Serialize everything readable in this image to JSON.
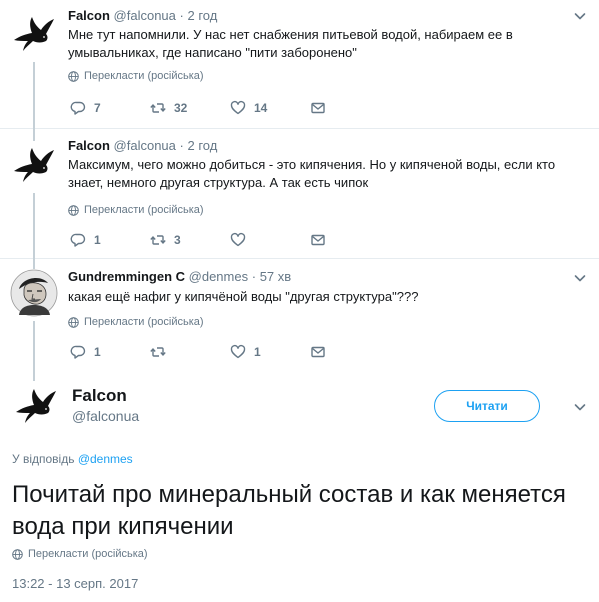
{
  "thread": [
    {
      "name": "Falcon",
      "handle": "@falconua",
      "dot": "·",
      "time": "2 год",
      "text": "Мне тут напомнили. У нас нет снабжения питьевой водой, набираем ее в умывальниках, где написано \"пити заборонено\"",
      "translate": "Перекласти (російська)",
      "replies": "7",
      "retweets": "32",
      "likes": "14",
      "avatar_icon": "crow-avatar-icon"
    },
    {
      "name": "Falcon",
      "handle": "@falconua",
      "dot": "·",
      "time": "2 год",
      "text": "Максимум, чего можно добиться - это кипячения. Но у кипяченой воды, если кто знает, немного другая структура. А так есть чипок",
      "translate": "Перекласти (російська)",
      "replies": "1",
      "retweets": "3",
      "likes": "",
      "avatar_icon": "crow-avatar-icon"
    },
    {
      "name": "Gundremmingen C",
      "handle": "@denmes",
      "dot": "·",
      "time": "57 хв",
      "text": "какая ещё нафиг у кипячёной воды \"другая структура\"???",
      "translate": "Перекласти (російська)",
      "replies": "1",
      "retweets": "",
      "likes": "1",
      "avatar_icon": "portrait-avatar-icon"
    }
  ],
  "main": {
    "name": "Falcon",
    "handle": "@falconua",
    "follow_label": "Читати",
    "reply_prefix": "У відповідь",
    "reply_mention": "@denmes",
    "text": "Почитай про минеральный состав и как меняется вода при кипячении",
    "translate": "Перекласти (російська)",
    "date": "13:22 - 13 серп. 2017"
  },
  "colors": {
    "accent": "#1da1f2",
    "secondary_text": "#657786",
    "thread_line": "#c4cfd6"
  }
}
